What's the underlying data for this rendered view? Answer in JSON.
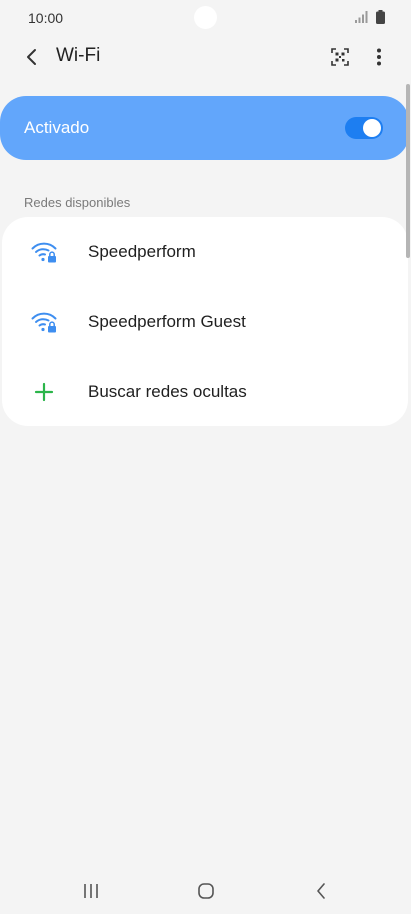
{
  "status_bar": {
    "time": "10:00"
  },
  "app_bar": {
    "title": "Wi-Fi",
    "back_icon": "chevron-left-icon",
    "qr_icon": "qr-code-scan-icon",
    "more_icon": "more-vertical-icon"
  },
  "wifi_toggle": {
    "label": "Activado",
    "enabled": true
  },
  "available_networks": {
    "header": "Redes disponibles",
    "items": [
      {
        "label": "Speedperform",
        "icon": "wifi-locked-icon"
      },
      {
        "label": "Speedperform Guest",
        "icon": "wifi-locked-icon"
      },
      {
        "label": "Buscar redes ocultas",
        "icon": "plus-icon"
      }
    ]
  },
  "colors": {
    "accent": "#62a6fb",
    "switch": "#1d7ef1",
    "wifi_icon": "#3e8ef0",
    "plus_icon": "#2bb54a",
    "background": "#f4f4f4",
    "card": "#ffffff"
  },
  "nav_bar": {
    "recents_icon": "recents-icon",
    "home_icon": "home-icon",
    "back_icon": "back-icon"
  }
}
